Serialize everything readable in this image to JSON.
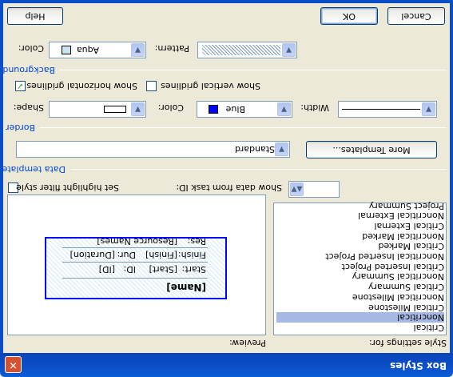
{
  "window": {
    "title": "Box Styles"
  },
  "labels": {
    "style_settings_for": "Style settings for:",
    "preview": "Preview:",
    "set_highlight_filter_style": "Set highlight filter style",
    "show_data_from_task_id": "Show data from task ID:",
    "data_template": "Data template",
    "border": "Border",
    "background": "Background",
    "shape": "Shape:",
    "border_color": "Color:",
    "width": "Width:",
    "bg_color": "Color:",
    "pattern": "Pattern:",
    "show_horizontal_gridlines": "Show horizontal gridlines",
    "show_vertical_gridlines": "Show vertical gridlines"
  },
  "style_list": [
    "Critical",
    "Noncritical",
    "Critical Milestone",
    "Noncritical Milestone",
    "Critical Summary",
    "Noncritical Summary",
    "Critical Inserted Project",
    "Noncritical Inserted Project",
    "Critical Marked",
    "Noncritical Marked",
    "Critical External",
    "Noncritical External",
    "Project Summary"
  ],
  "selected_style": "Noncritical",
  "task_id_value": "",
  "template_value": "Standard",
  "border_color_value": "Blue",
  "bg_color_value": "Aqua",
  "checkboxes": {
    "highlight_filter": false,
    "horizontal_gridlines": true,
    "vertical_gridlines": false
  },
  "preview_box": {
    "name": "[Name]",
    "start_label": "Start:",
    "start_value": "[Start]",
    "id_label": "ID:",
    "id_value": "[ID]",
    "finish_label": "Finish:",
    "finish_value": "[Finish]",
    "dur_label": "Dur:",
    "dur_value": "[Duration]",
    "res_label": "Res:",
    "res_value": "[Resource Names]"
  },
  "buttons": {
    "more_templates": "More Templates...",
    "help": "Help",
    "ok": "OK",
    "cancel": "Cancel"
  },
  "colors": {
    "title_bar": "#0b4fc8",
    "close_button": "#d8512f",
    "border_blue": "#0000ff",
    "aqua": "#c9e6f0",
    "selection": "#a6b8e4"
  },
  "icons": [
    "close-icon",
    "dropdown-arrow-icon",
    "spinner-icon",
    "checkmark-icon"
  ]
}
